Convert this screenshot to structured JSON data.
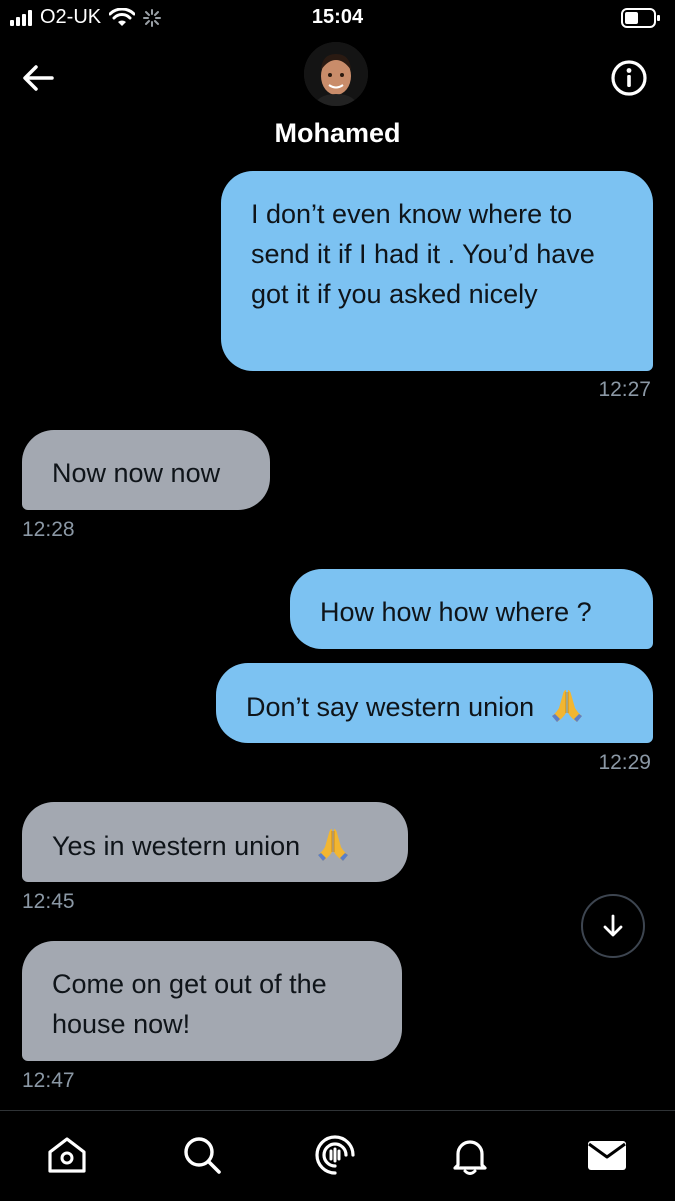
{
  "status_bar": {
    "carrier": "O2-UK",
    "time": "15:04"
  },
  "header": {
    "contact_name": "Mohamed"
  },
  "messages": [
    {
      "direction": "sent",
      "text": "I don’t even know where to send it if I had it . You’d have got it if you asked nicely",
      "time": "12:27"
    },
    {
      "direction": "received",
      "text": "Now now now",
      "time": "12:28"
    },
    {
      "direction": "sent",
      "text": "How how how where ?",
      "time": ""
    },
    {
      "direction": "sent",
      "text": "Don’t say western union",
      "emoji": "folded-hands",
      "time": "12:29"
    },
    {
      "direction": "received",
      "text": "Yes in western union",
      "emoji": "folded-hands",
      "time": "12:45"
    },
    {
      "direction": "received",
      "text": "Come on get out of the house now!",
      "time": "12:47"
    }
  ],
  "tab_bar": {
    "tabs": [
      "home-icon",
      "search-icon",
      "spaces-icon",
      "notifications-icon",
      "messages-icon"
    ],
    "active": "messages-icon"
  },
  "colors": {
    "background": "#000000",
    "sent_bubble": "#7cc2f2",
    "received_bubble": "#a3a8b1",
    "timestamp": "#8b98a5",
    "bubble_text": "#0f1419"
  }
}
